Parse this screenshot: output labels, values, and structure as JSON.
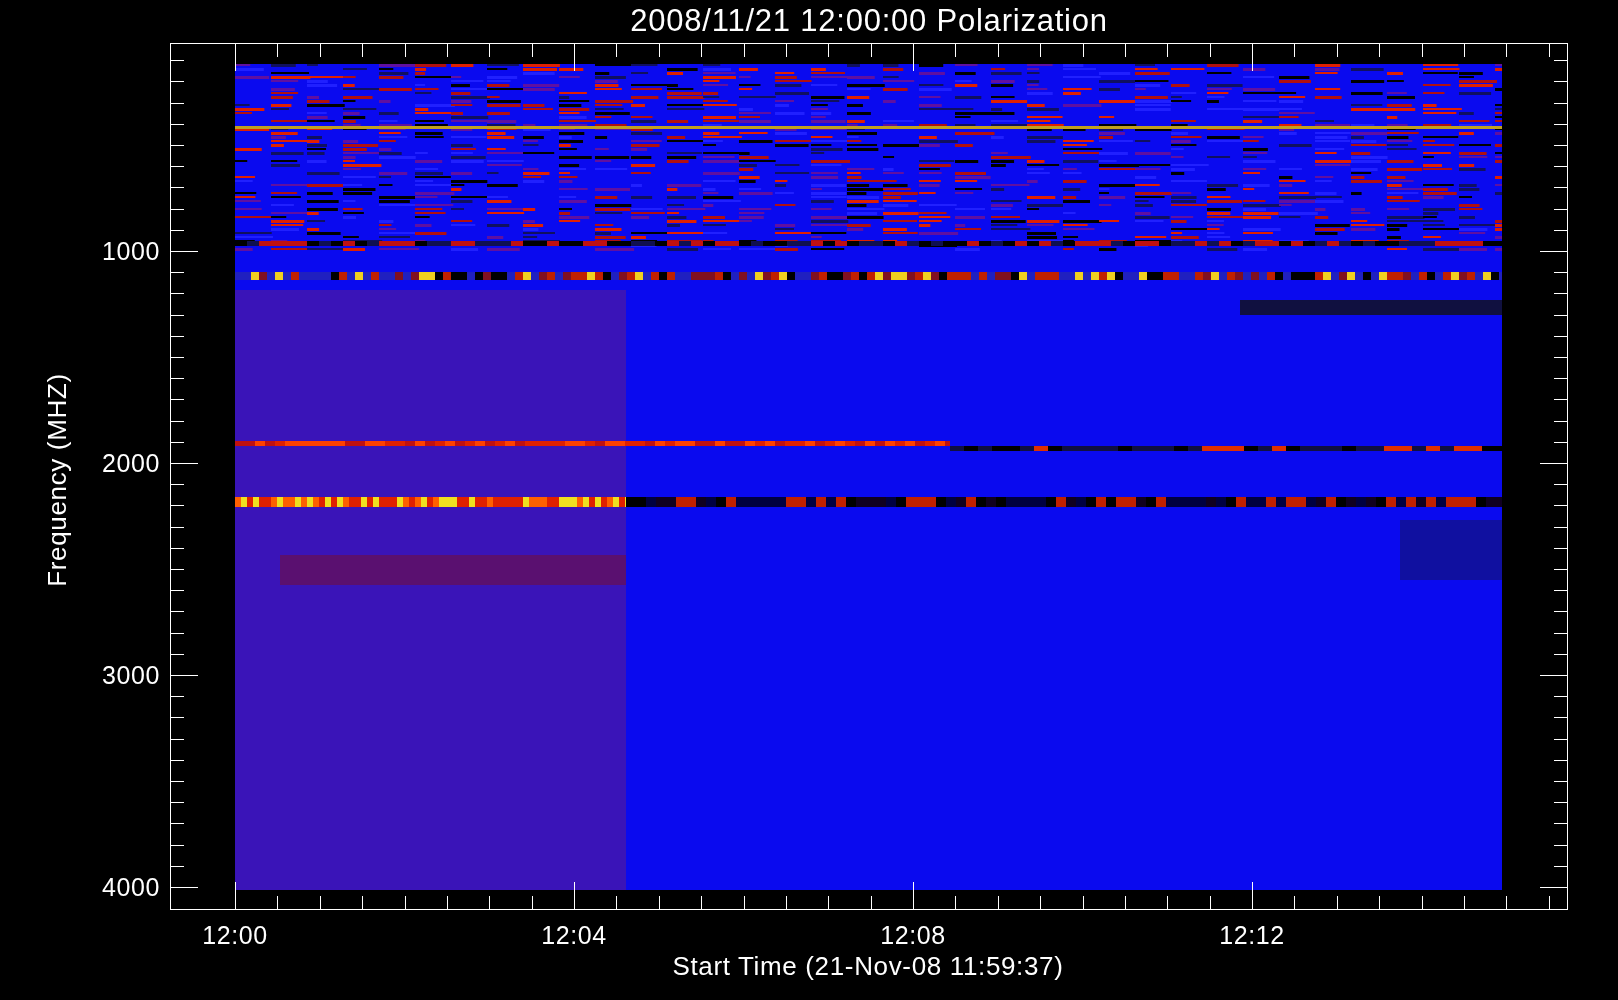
{
  "title": "2008/11/21 12:00:00 Polarization",
  "y_axis": {
    "label": "Frequency (MHZ)",
    "ticks": [
      "1000",
      "2000",
      "3000",
      "4000"
    ]
  },
  "x_axis": {
    "label": "Start Time (21-Nov-08 11:59:37)",
    "ticks": [
      "12:00",
      "12:04",
      "12:08",
      "12:12"
    ]
  }
}
